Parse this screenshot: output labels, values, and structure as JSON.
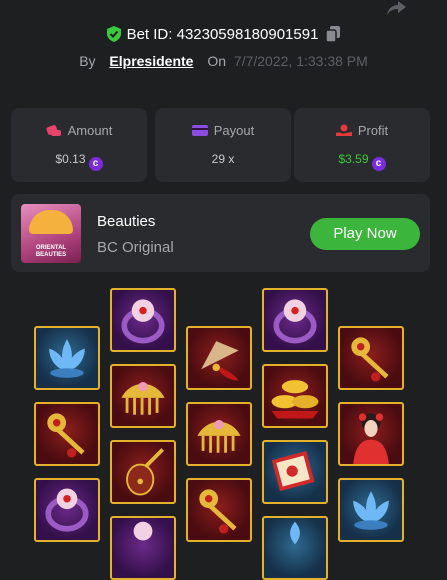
{
  "header": {
    "bet_id_text": "Bet ID: 43230598180901591",
    "by_label": "By",
    "username": "Elpresidente",
    "on_label": "On",
    "date": "7/7/2022, 1:33:38 PM"
  },
  "stats": [
    {
      "label": "Amount",
      "value": "$0.13",
      "coin": true
    },
    {
      "label": "Payout",
      "value": "29 x",
      "coin": false
    },
    {
      "label": "Profit",
      "value": "$3.59",
      "coin": true
    }
  ],
  "coin_symbol": "c",
  "game": {
    "name": "Beauties",
    "subtitle": "BC Original",
    "play_label": "Play Now",
    "thumb_text": "ORIENTAL BEAUTIES"
  },
  "colors": {
    "background": "#1e1f21",
    "card": "#2a2b2e",
    "accent_green": "#3bb53b",
    "profit_green": "#3cc83c",
    "coin_purple": "#7b2cdc",
    "tile_border": "#e4b12a"
  },
  "icons": {
    "share": "share-icon",
    "verified": "shield-check-icon",
    "copy": "copy-icon",
    "amount": "amount-icon",
    "payout": "payout-icon",
    "profit": "profit-icon"
  },
  "reels": [
    [
      "blue-lotus",
      "golden-hairpin",
      "lotus-ring"
    ],
    [
      "lotus-ring",
      "jade-comb",
      "pipa-lute"
    ],
    [
      "red-fan",
      "jade-comb",
      "golden-hairpin"
    ],
    [
      "lotus-ring",
      "gold-ingots",
      "red-book"
    ],
    [
      "golden-hairpin",
      "beauty-lady",
      "blue-lotus"
    ]
  ]
}
